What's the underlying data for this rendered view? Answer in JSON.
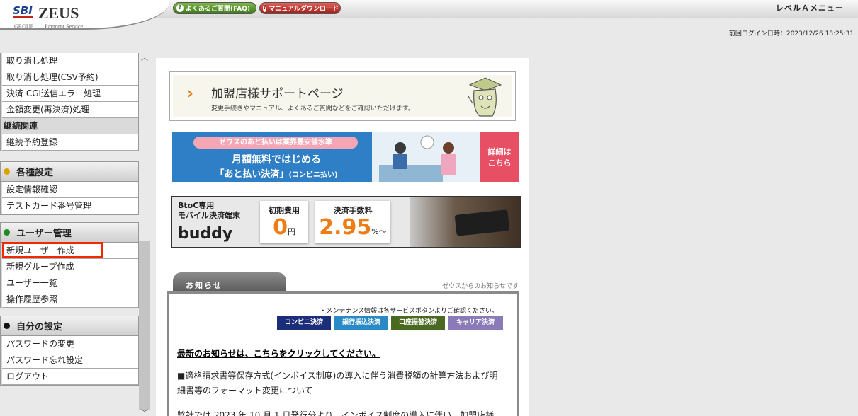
{
  "header": {
    "logo_sbi": "SBI",
    "logo_zeus": "ZEUS",
    "logo_group": "GROUP",
    "logo_sub": "Payment Service",
    "faq_button": "よくあるご質問(FAQ)",
    "manual_button": "マニュアルダウンロード",
    "level_menu": "レベルＡメニュー",
    "last_login": "前回ログイン日時：2023/12/26 18:25:31"
  },
  "sidebar": {
    "top_items": [
      "取り消し処理",
      "取り消し処理(CSV予約)",
      "決済 CGI送信エラー処理",
      "金額変更(再決済)処理"
    ],
    "continuation_header": "継続関連",
    "continuation_item": "継続予約登録",
    "settings_title": "各種設定",
    "settings_items": [
      "設定情報確認",
      "テストカード番号管理"
    ],
    "user_title": "ユーザー管理",
    "user_items": [
      "新規ユーザー作成",
      "新規グループ作成",
      "ユーザー一覧",
      "操作履歴参照"
    ],
    "my_title": "自分の設定",
    "my_items": [
      "パスワードの変更",
      "パスワード忘れ設定",
      "ログアウト"
    ],
    "dot_colors": {
      "settings": "#d9a400",
      "user": "#1f8a1f",
      "my": "#111111"
    }
  },
  "main": {
    "support_title": "加盟店様サポートページ",
    "support_sub": "変更手続きやマニュアル、よくあるご質問などをご確認いただけます。",
    "banner1": {
      "pill": "ゼウスのあと払いは業界最安値水準",
      "line1": "月額無料ではじめる",
      "line2": "「あと払い決済」",
      "line2_small": "(コンビニ払い)",
      "cta": "詳細は\nこちら"
    },
    "banner2": {
      "label1": "BtoC専用",
      "label2": "モバイル決済端末",
      "product": "buddy",
      "initial_label": "初期費用",
      "initial_value": "0",
      "initial_unit": "円",
      "fee_label": "決済手数料",
      "fee_value": "2.95",
      "fee_unit": "%～"
    },
    "news": {
      "tab": "お知らせ",
      "from": "ゼウスからのお知らせです",
      "note": "・メンテナンス情報は各サービスボタンよりご確認ください。",
      "buttons": [
        "コンビニ決済",
        "銀行振込決済",
        "口座振替決済",
        "キャリア決済"
      ],
      "button_colors": [
        "#1c2d7a",
        "#2a8ac6",
        "#4a6a22",
        "#8b7ab8"
      ],
      "link": "最新のお知らせは、こちらをクリックしてください。",
      "body1": "■適格請求書等保存方式(インボイス制度)の導入に伴う消費税額の計算方法および明細書等のフォーマット変更について",
      "body2": "弊社では 2023 年 10 月 1 日発行分より、インボイス制度の導入に伴い、加盟店様"
    }
  }
}
